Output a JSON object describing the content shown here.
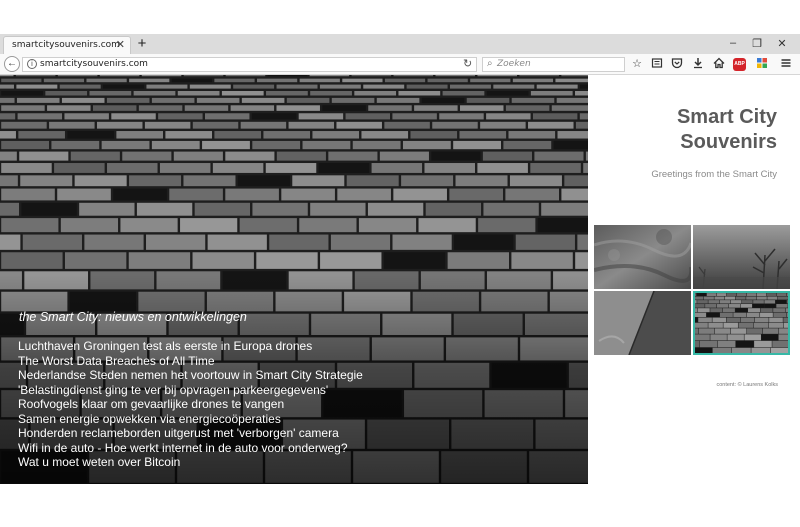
{
  "browser": {
    "tab_title": "smartcitysouvenirs.com",
    "tab_close": "✕",
    "new_tab": "+",
    "url": "smartcitysouvenirs.com",
    "search_placeholder": "Zoeken",
    "window_controls": [
      "–",
      "❐",
      "✕"
    ],
    "toolbar_icons": [
      "star-icon",
      "reading-list-icon",
      "pocket-icon",
      "download-icon",
      "home-icon",
      "adblock-icon",
      "extension-icon",
      "menu-icon"
    ],
    "adblock_label": "ABP"
  },
  "hero": {
    "heading": "the Smart City: nieuws en ontwikkelingen",
    "news": [
      "Luchthaven Groningen test als eerste in Europa drones",
      "The Worst Data Breaches of All Time",
      "Nederlandse Steden nemen het voortouw in Smart City Strategie",
      "'Belastingdienst ging te ver bij opvragen parkeergegevens'",
      "Roofvogels klaar om gevaarlijke drones te vangen",
      "Samen energie opwekken via energiecoöperaties",
      "Honderden reclameborden uitgerust met 'verborgen' camera",
      "Wifi in de auto - Hoe werkt internet in de auto voor onderweg?",
      "Wat u moet weten over Bitcoin"
    ]
  },
  "sidebar": {
    "title_line1": "Smart City",
    "title_line2": "Souvenirs",
    "subtitle": "Greetings from the Smart City",
    "credit": "content: © Laurens Kolks",
    "accent_color": "#36b8a6",
    "thumbnails": [
      "wet-concrete-texture",
      "foggy-trees",
      "concrete-wall-corner",
      "building-facade"
    ]
  }
}
